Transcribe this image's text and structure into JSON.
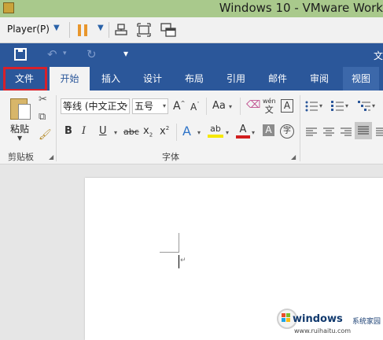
{
  "vmware": {
    "title": "Windows 10 - VMware Work",
    "player_menu": "Player(P)"
  },
  "word": {
    "doc_title": "文",
    "tabs": [
      {
        "label": "文件"
      },
      {
        "label": "开始"
      },
      {
        "label": "插入"
      },
      {
        "label": "设计"
      },
      {
        "label": "布局"
      },
      {
        "label": "引用"
      },
      {
        "label": "邮件"
      },
      {
        "label": "审阅"
      },
      {
        "label": "视图"
      }
    ],
    "active_tab": "开始",
    "highlighted_tab": "文件",
    "highlight_color": "#d8202a",
    "accent_color": "#2b579a",
    "clipboard": {
      "paste_label": "粘贴",
      "group_label": "剪贴板"
    },
    "font": {
      "font_name": "等线 (中文正文",
      "font_size": "五号",
      "group_label": "字体",
      "grow_label": "A",
      "shrink_label": "A",
      "case_label": "Aa",
      "phonetic_label": "wén",
      "phonetic_char": "文",
      "boxed_label": "A",
      "bold_label": "B",
      "italic_label": "I",
      "underline_label": "U",
      "strike_label": "abc",
      "subscript_label": "x",
      "superscript_label": "x",
      "effects_label": "A",
      "highlight_label": "ab",
      "color_label": "A",
      "shading_label": "A",
      "enclose_label": "字"
    }
  },
  "watermark": {
    "brand": "windows",
    "cn": "系统家园",
    "url": "www.ruihaitu.com"
  }
}
